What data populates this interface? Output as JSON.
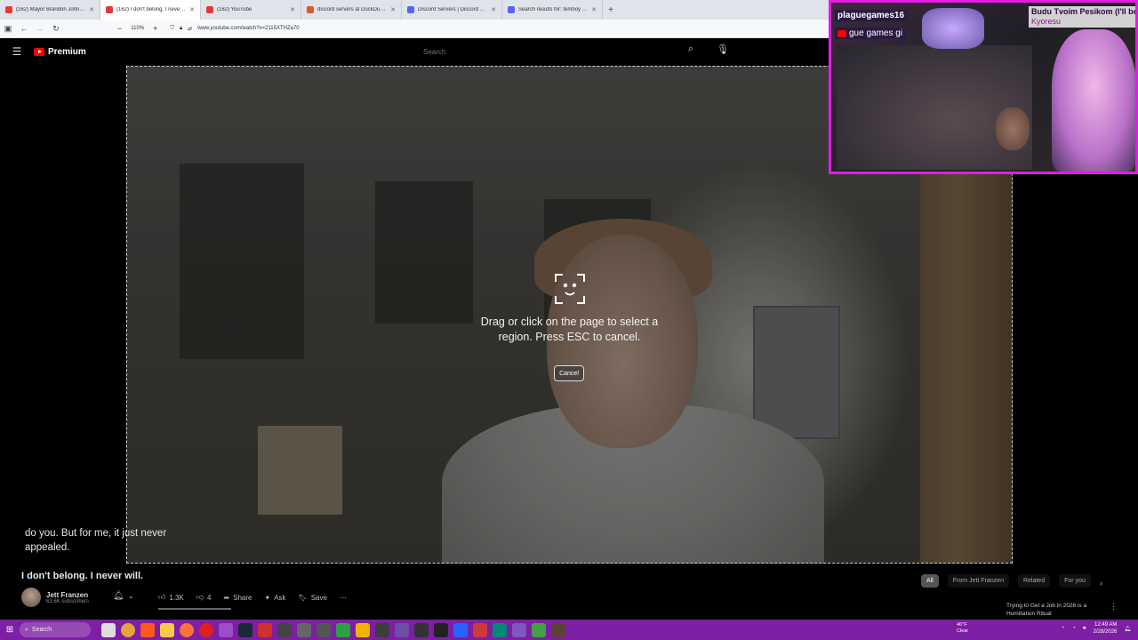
{
  "browser": {
    "tabs": [
      {
        "title": "(162) Mayor Brandon Johnson I",
        "color": "#e53935",
        "active": false
      },
      {
        "title": "(162) I don't belong. I never wil",
        "color": "#e53935",
        "active": true
      },
      {
        "title": "(162) YouTube",
        "color": "#e53935",
        "active": false
      },
      {
        "title": "discord servers at DuckDuckGo",
        "color": "#de5833",
        "active": false
      },
      {
        "title": "Discord Servers | Discord Server",
        "color": "#5865f2",
        "active": false
      },
      {
        "title": "Search results for: femboy | Dis",
        "color": "#5865f2",
        "active": false
      }
    ],
    "zoom_level": "110%",
    "url": "www.youtube.com/watch?v=2115XTHZa70"
  },
  "youtube": {
    "logo_text": "Premium",
    "search_placeholder": "Search"
  },
  "screenshot_tool": {
    "prompt_text": "Drag or click on the page to select a region. Press ESC to cancel.",
    "cancel_label": "Cancel"
  },
  "video": {
    "caption": "do you. But for me, it just never appealed.",
    "title": "I don't belong. I never will.",
    "channel_name": "Jett Franzen",
    "subscribers": "63.6K subscribers",
    "likes": "1.3K",
    "dislikes": "4",
    "share_label": "Share",
    "ask_label": "Ask",
    "save_label": "Save"
  },
  "filter_chips": [
    {
      "label": "All",
      "active": true
    },
    {
      "label": "From Jett Franzen",
      "active": false
    },
    {
      "label": "Related",
      "active": false
    },
    {
      "label": "For you",
      "active": false
    }
  ],
  "side_video": {
    "title": "Trying to Get a Job in 2026 is a Humiliation Ritual"
  },
  "stream_overlay": {
    "streamer": "plaguegames16",
    "streamer_tag2": "gue games gi",
    "song_title": "Budu Tvoim Pesikom (I'll be",
    "song_artist": "Kyoresu",
    "border_color": "#e01ee0"
  },
  "taskbar": {
    "search_label": "Search",
    "weather_temp": "46°F",
    "weather_desc": "Clear",
    "time": "12:49 AM",
    "date": "2/28/2026",
    "color": "#7c1fa2"
  }
}
